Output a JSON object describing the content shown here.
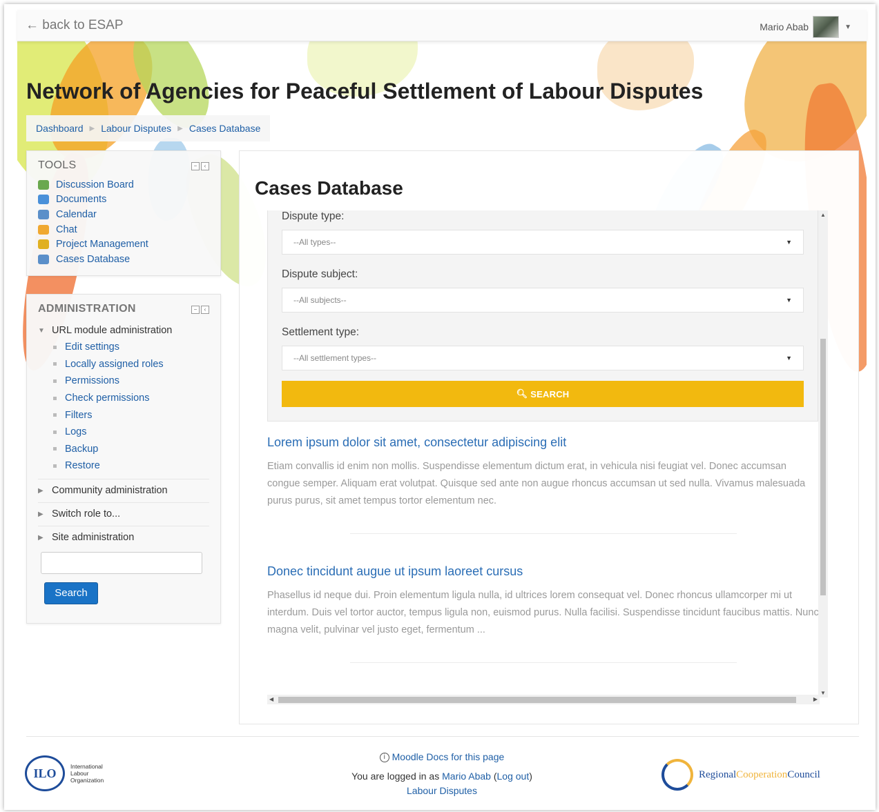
{
  "topbar": {
    "back_label": "← back to ESAP",
    "user_name": "Mario Abab"
  },
  "site": {
    "title": "Network of Agencies for Peaceful Settlement of Labour Disputes"
  },
  "breadcrumb": [
    "Dashboard",
    "Labour Disputes",
    "Cases Database"
  ],
  "tools": {
    "title": "TOOLS",
    "items": [
      {
        "label": "Discussion Board",
        "icon": "discussion-icon",
        "color": "#6aa84f"
      },
      {
        "label": "Documents",
        "icon": "folder-icon",
        "color": "#4a90d9"
      },
      {
        "label": "Calendar",
        "icon": "calendar-icon",
        "color": "#5b8fc9"
      },
      {
        "label": "Chat",
        "icon": "chat-icon",
        "color": "#f0a830"
      },
      {
        "label": "Project Management",
        "icon": "project-icon",
        "color": "#e0b020"
      },
      {
        "label": "Cases Database",
        "icon": "database-icon",
        "color": "#5b8fc9"
      }
    ]
  },
  "admin": {
    "title": "ADMINISTRATION",
    "section": "URL module administration",
    "items": [
      "Edit settings",
      "Locally assigned roles",
      "Permissions",
      "Check permissions",
      "Filters",
      "Logs",
      "Backup",
      "Restore"
    ],
    "collapsed": [
      "Community administration",
      "Switch role to...",
      "Site administration"
    ],
    "search_value": "",
    "search_button": "Search"
  },
  "main": {
    "title": "Cases Database",
    "filters": {
      "dispute_type_label": "Dispute type:",
      "dispute_type_value": "--All types--",
      "dispute_subject_label": "Dispute subject:",
      "dispute_subject_value": "--All subjects--",
      "settlement_type_label": "Settlement type:",
      "settlement_type_value": "--All settlement types--",
      "search_label": "SEARCH"
    },
    "results": [
      {
        "title": "Lorem ipsum dolor sit amet, consectetur adipiscing elit",
        "body": "Etiam convallis id enim non mollis. Suspendisse elementum dictum erat, in vehicula nisi feugiat vel. Donec accumsan congue semper. Aliquam erat volutpat. Quisque sed ante non augue rhoncus accumsan ut sed nulla. Vivamus malesuada purus purus, sit amet tempus tortor elementum nec."
      },
      {
        "title": "Donec tincidunt augue ut ipsum laoreet cursus",
        "body": "Phasellus id neque dui. Proin elementum ligula nulla, id ultrices lorem consequat vel. Donec rhoncus ullamcorper mi ut interdum. Duis vel tortor auctor, tempus ligula non, euismod purus. Nulla facilisi. Suspendisse tincidunt faucibus mattis. Nunc magna velit, pulvinar vel justo eget, fermentum ..."
      }
    ]
  },
  "footer": {
    "docs_link": "Moodle Docs for this page",
    "logged_in_prefix": "You are logged in as",
    "user_link": "Mario Abab",
    "logout_link": "Log out",
    "course_link": "Labour Disputes",
    "ilo_lines": [
      "International",
      "Labour",
      "Organization"
    ],
    "ilo_seal": "ILO",
    "rcc_parts": [
      "Regional",
      "Cooperation",
      "Council"
    ]
  },
  "colors": {
    "accent": "#f2b90f",
    "link": "#1f5fa6",
    "button": "#1a73c6"
  }
}
